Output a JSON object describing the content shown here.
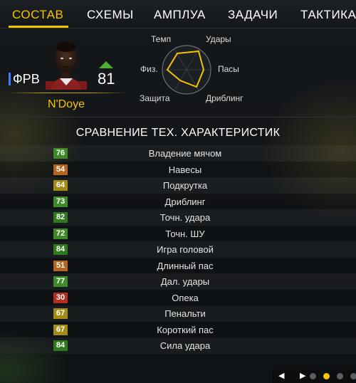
{
  "tabs": [
    {
      "label": "СОСТАВ",
      "active": true
    },
    {
      "label": "СХЕМЫ",
      "active": false
    },
    {
      "label": "АМПЛУА",
      "active": false
    },
    {
      "label": "ЗАДАЧИ",
      "active": false
    },
    {
      "label": "ТАКТИКА",
      "active": false
    }
  ],
  "player": {
    "position": "ФРВ",
    "overall": "81",
    "name": "N'Doye"
  },
  "radar": {
    "labels": {
      "pace": "Темп",
      "shooting": "Удары",
      "passing": "Пасы",
      "dribbling": "Дриблинг",
      "defending": "Защита",
      "physical": "Физ."
    }
  },
  "comparison": {
    "title": "СРАВНЕНИЕ ТЕХ. ХАРАКТЕРИСТИК",
    "stats": [
      {
        "value": "76",
        "label": "Владение мячом",
        "color": "#3e8a27"
      },
      {
        "value": "54",
        "label": "Навесы",
        "color": "#b5651d"
      },
      {
        "value": "64",
        "label": "Подкрутка",
        "color": "#a38b14"
      },
      {
        "value": "73",
        "label": "Дриблинг",
        "color": "#3e8a27"
      },
      {
        "value": "82",
        "label": "Точн. удара",
        "color": "#2f7a1c"
      },
      {
        "value": "72",
        "label": "Точн. ШУ",
        "color": "#3e8a27"
      },
      {
        "value": "84",
        "label": "Игра головой",
        "color": "#2f7a1c"
      },
      {
        "value": "51",
        "label": "Длинный пас",
        "color": "#b5651d"
      },
      {
        "value": "77",
        "label": "Дал. удары",
        "color": "#3e8a27"
      },
      {
        "value": "30",
        "label": "Опека",
        "color": "#b32f1f"
      },
      {
        "value": "67",
        "label": "Пенальти",
        "color": "#a38b14"
      },
      {
        "value": "67",
        "label": "Короткий пас",
        "color": "#a38b14"
      },
      {
        "value": "84",
        "label": "Сила удара",
        "color": "#2f7a1c"
      }
    ]
  },
  "colors": {
    "accent": "#f4c400",
    "position_marker": "#3d7cff",
    "overall_arrow": "#4caf2f"
  },
  "pager": {
    "active_index": 2,
    "count": 4
  }
}
